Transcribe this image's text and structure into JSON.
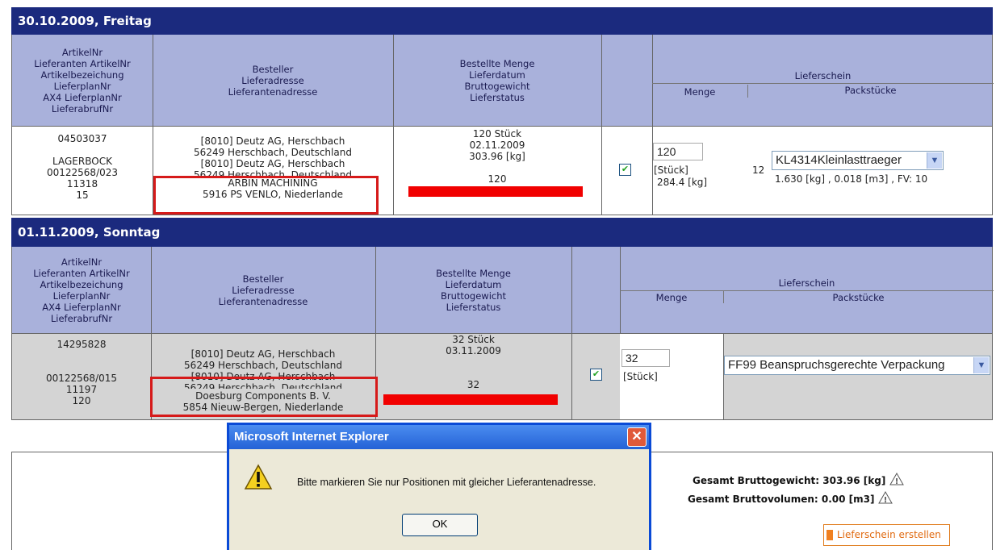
{
  "section1": {
    "date_title": "30.10.2009, Freitag",
    "headers": {
      "col1": [
        "ArtikelNr",
        "Lieferanten ArtikelNr",
        "Artikelbezeichung",
        "LieferplanNr",
        "AX4 LieferplanNr",
        "LieferabrufNr"
      ],
      "col2": [
        "Besteller",
        "Lieferadresse",
        "Lieferantenadresse"
      ],
      "col3": [
        "Bestellte Menge",
        "Lieferdatum",
        "Bruttogewicht",
        "Lieferstatus"
      ],
      "lieferschein": "Lieferschein",
      "menge": "Menge",
      "packstuecke": "Packstücke"
    },
    "row": {
      "artikelnr": "04503037",
      "bezeichnung": "LAGERBOCK",
      "lieferplan": "00122568/023",
      "ax4": "11318",
      "abruf": "15",
      "addr1": "[8010] Deutz AG,  Herschbach",
      "addr2": "56249 Herschbach,  Deutschland",
      "addr3": "[8010] Deutz AG,  Herschbach",
      "addr4": "56249 Herschbach,  Deutschland",
      "supplier1": "ARBIN MACHINING",
      "supplier2": "5916 PS VENLO,  Niederlande",
      "menge": "120 Stück",
      "datum": "02.11.2009",
      "gewicht": "303.96 [kg]",
      "status": "120",
      "checked": "✔",
      "input_menge": "120",
      "unit": "[Stück]",
      "kg": "284.4 [kg]",
      "pack_count": "12",
      "pack_select": "KL4314Kleinlasttraeger",
      "pack_info": "1.630 [kg] ,  0.018 [m3] , FV: 10"
    }
  },
  "section2": {
    "date_title": "01.11.2009, Sonntag",
    "headers": {
      "col1": [
        "ArtikelNr",
        "Lieferanten ArtikelNr",
        "Artikelbezeichung",
        "LieferplanNr",
        "AX4 LieferplanNr",
        "LieferabrufNr"
      ],
      "col2": [
        "Besteller",
        "Lieferadresse",
        "Lieferantenadresse"
      ],
      "col3": [
        "Bestellte Menge",
        "Lieferdatum",
        "Bruttogewicht",
        "Lieferstatus"
      ],
      "lieferschein": "Lieferschein",
      "menge": "Menge",
      "packstuecke": "Packstücke"
    },
    "row": {
      "artikelnr": "14295828",
      "lieferplan": "00122568/015",
      "ax4": "11197",
      "abruf": "120",
      "addr1": "[8010] Deutz AG,  Herschbach",
      "addr2": "56249 Herschbach,  Deutschland",
      "addr3": "[8010] Deutz AG,  Herschbach",
      "addr4": "56249 Herschbach,  Deutschland",
      "supplier1": "Doesburg Components B. V.",
      "supplier2": "5854 Nieuw-Bergen,  Niederlande",
      "menge": "32 Stück",
      "datum": "03.11.2009",
      "status": "32",
      "checked": "✔",
      "input_menge": "32",
      "unit": "[Stück]",
      "pack_select": "FF99 Beanspruchsgerechte Verpackung"
    }
  },
  "summary": {
    "gewicht_label": "Gesamt Bruttogewicht:",
    "gewicht_value": "303.96 [kg]",
    "volumen_label": "Gesamt Bruttovolumen:",
    "volumen_value": "0.00 [m3]",
    "create_button": "Lieferschein erstellen"
  },
  "dialog": {
    "title": "Microsoft Internet Explorer",
    "message": "Bitte markieren Sie nur Positionen mit gleicher Lieferantenadresse.",
    "ok": "OK",
    "close": "✕"
  },
  "colors": {
    "header_bar": "#1b2a7e",
    "header_row": "#a9b1db",
    "status_bar": "#f10000",
    "highlight_box": "#d61a1a",
    "button_orange": "#e06a10"
  }
}
